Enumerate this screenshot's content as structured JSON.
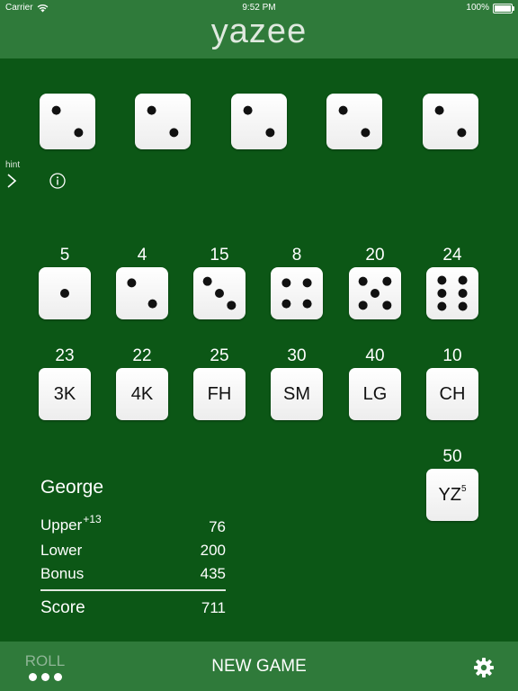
{
  "status_bar": {
    "carrier": "Carrier",
    "time": "9:52 PM",
    "battery": "100%",
    "battery_level": 1.0
  },
  "header": {
    "title": "yazee"
  },
  "held_dice": [
    2,
    2,
    2,
    2,
    2
  ],
  "controls": {
    "hint_label": "hint"
  },
  "upper_categories": [
    {
      "score": "5",
      "face": 1
    },
    {
      "score": "4",
      "face": 2
    },
    {
      "score": "15",
      "face": 3
    },
    {
      "score": "8",
      "face": 4
    },
    {
      "score": "20",
      "face": 5
    },
    {
      "score": "24",
      "face": 6
    }
  ],
  "lower_categories": [
    {
      "score": "23",
      "label": "3K"
    },
    {
      "score": "22",
      "label": "4K"
    },
    {
      "score": "25",
      "label": "FH"
    },
    {
      "score": "30",
      "label": "SM"
    },
    {
      "score": "40",
      "label": "LG"
    },
    {
      "score": "10",
      "label": "CH"
    }
  ],
  "yahtzee": {
    "score": "50",
    "label": "YZ",
    "sup": "5"
  },
  "scoreboard": {
    "player": "George",
    "upper_label": "Upper",
    "upper_bonus_hint": "+13",
    "upper_value": "76",
    "lower_label": "Lower",
    "lower_value": "200",
    "bonus_label": "Bonus",
    "bonus_value": "435",
    "score_label": "Score",
    "score_value": "711"
  },
  "bottom_bar": {
    "roll_label": "ROLL",
    "new_game_label": "NEW GAME"
  },
  "colors": {
    "felt": "#0c5716",
    "bar": "#2f7a3a",
    "pip": "#111111"
  }
}
